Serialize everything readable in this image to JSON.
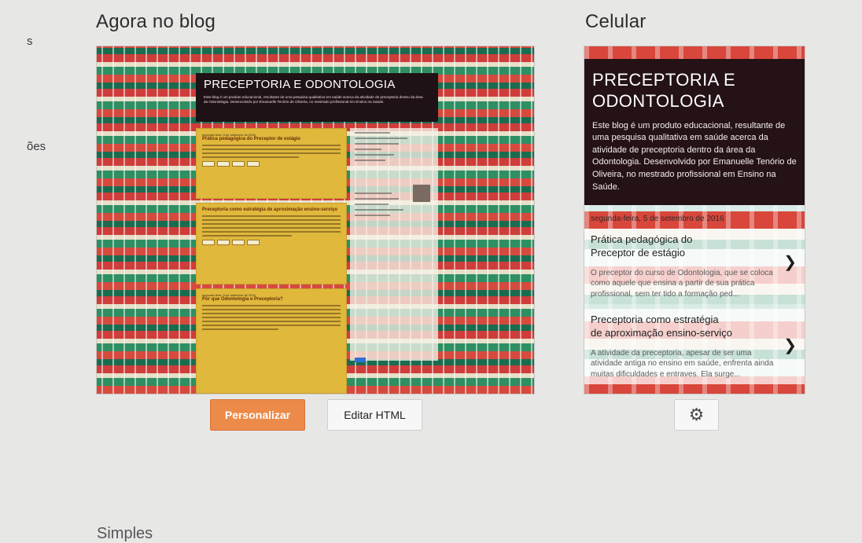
{
  "sidebar_fragments": [
    "s",
    "ões"
  ],
  "sections": {
    "desktop_heading": "Agora no blog",
    "mobile_heading": "Celular"
  },
  "blog": {
    "title_desktop": "PRECEPTORIA E ODONTOLOGIA",
    "title_mobile": "PRECEPTORIA E ODONTOLOGIA",
    "description": "Este blog é um produto educacional, resultante de uma pesquisa qualitativa em saúde acerca da atividade de preceptoria dentro da área da Odontologia. Desenvolvido por Emanuelle Tenório de Oliveira, no mestrado profissional em Ensino na Saúde.",
    "post_date": "segunda-feira, 5 de setembro de 2016",
    "posts": [
      {
        "title": "Prática pedagógica do Preceptor de estágio",
        "snippet": "O preceptor do curso de Odontologia, que se coloca como aquele que ensina a partir de sua prática profissional, sem ter tido a formação ped..."
      },
      {
        "title": "Preceptoria como estratégia de aproximação ensino-serviço",
        "snippet": "A atividade da preceptoria, apesar de ser uma atividade antiga no ensino em saúde, enfrenta ainda muitas dificuldades e entraves. Ela surge..."
      },
      {
        "title": "Por que Odontologia e Preceptoria?",
        "snippet": ""
      }
    ]
  },
  "actions": {
    "customize_label": "Personalizar",
    "edit_html_label": "Editar HTML",
    "mobile_settings_icon": "gear-icon"
  },
  "bottom_fragment": "Simples",
  "colors": {
    "primary_button": "#ec8a49",
    "header_bg": "#241216",
    "post_bg": "#e0b83c"
  }
}
